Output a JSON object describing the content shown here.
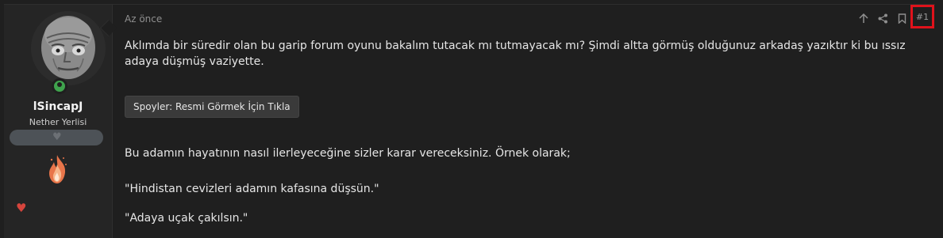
{
  "user": {
    "name": "lSincapJ",
    "title": "Nether Yerlisi",
    "status": "online"
  },
  "post": {
    "time": "Az önce",
    "number": "#1",
    "paragraphs": [
      "Aklımda bir süredir olan bu garip forum oyunu bakalım tutacak mı tutmayacak mı? Şimdi altta görmüş olduğunuz arkadaş yazıktır ki bu ıssız adaya düşmüş vaziyette.",
      "Bu adamın hayatının nasıl ilerleyeceğine sizler karar vereceksiniz. Örnek olarak;",
      "\"Hindistan cevizleri adamın kafasına düşsün.\"",
      "\"Adaya uçak çakılsın.\""
    ],
    "spoiler_label": "Spoyler: Resmi Görmek İçin Tıkla"
  },
  "actions": {
    "icons": [
      "arrow-up-icon",
      "share-icon",
      "bookmark-icon"
    ]
  },
  "colors": {
    "highlight": "#e0121b",
    "online": "#3fa34d",
    "reaction": "#d6453d"
  }
}
